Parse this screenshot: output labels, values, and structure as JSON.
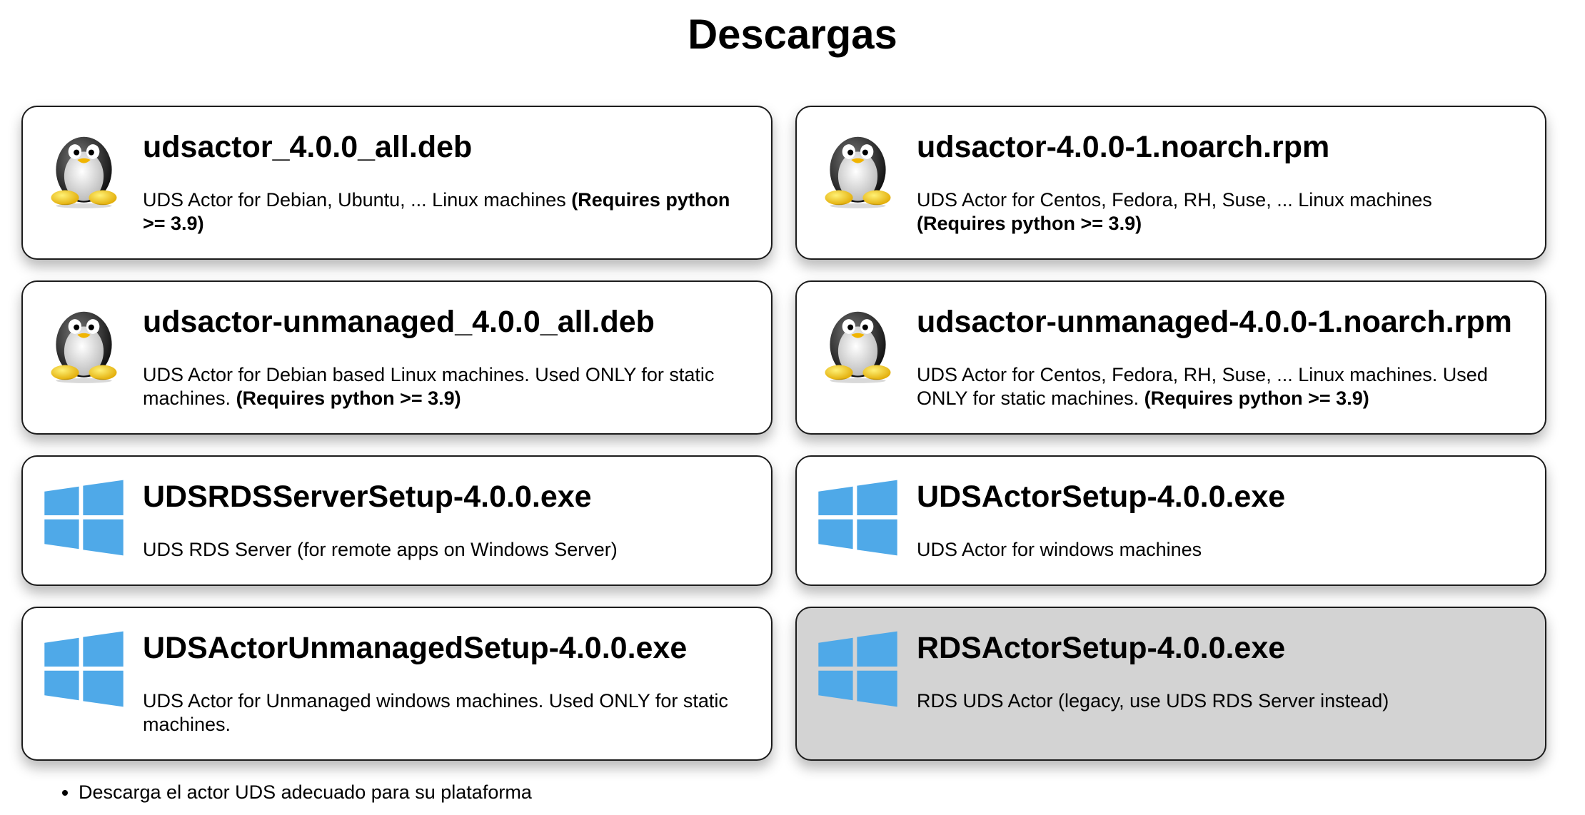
{
  "page": {
    "title": "Descargas"
  },
  "downloads": [
    {
      "icon": "linux-penguin-icon",
      "title": "udsactor_4.0.0_all.deb",
      "desc": "UDS Actor for Debian, Ubuntu, ... Linux machines ",
      "req": "(Requires python >= 3.9)"
    },
    {
      "icon": "linux-penguin-icon",
      "title": "udsactor-4.0.0-1.noarch.rpm",
      "desc": "UDS Actor for Centos, Fedora, RH, Suse, ... Linux machines ",
      "req": "(Requires python >= 3.9)"
    },
    {
      "icon": "linux-penguin-icon",
      "title": "udsactor-unmanaged_4.0.0_all.deb",
      "desc": "UDS Actor for Debian based Linux machines. Used ONLY for static machines. ",
      "req": "(Requires python >= 3.9)"
    },
    {
      "icon": "linux-penguin-icon",
      "title": "udsactor-unmanaged-4.0.0-1.noarch.rpm",
      "desc": "UDS Actor for Centos, Fedora, RH, Suse, ... Linux machines. Used ONLY for static machines. ",
      "req": "(Requires python >= 3.9)"
    },
    {
      "icon": "windows-logo-icon",
      "title": "UDSRDSServerSetup-4.0.0.exe",
      "desc": "UDS RDS Server (for remote apps on Windows Server)",
      "req": ""
    },
    {
      "icon": "windows-logo-icon",
      "title": "UDSActorSetup-4.0.0.exe",
      "desc": "UDS Actor for windows machines",
      "req": ""
    },
    {
      "icon": "windows-logo-icon",
      "title": "UDSActorUnmanagedSetup-4.0.0.exe",
      "desc": "UDS Actor for Unmanaged windows machines. Used ONLY for static machines.",
      "req": ""
    },
    {
      "icon": "windows-logo-icon",
      "title": "RDSActorSetup-4.0.0.exe",
      "desc": "RDS UDS Actor (legacy, use UDS RDS Server instead)",
      "req": "",
      "legacy": true
    }
  ],
  "notes": [
    "Descarga el actor UDS adecuado para su plataforma"
  ],
  "colors": {
    "windows_blue": "#4fa9e8",
    "legacy_card_bg": "#d3d3d3",
    "card_border": "#1c1c1c"
  }
}
